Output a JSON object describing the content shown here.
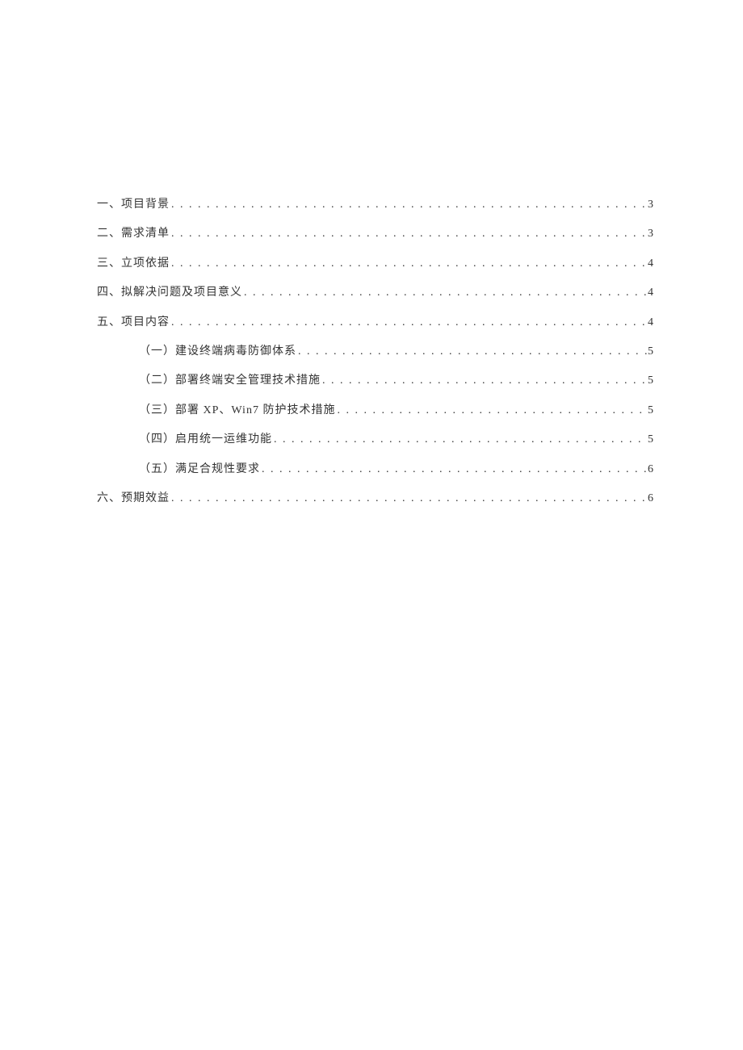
{
  "toc": [
    {
      "level": 1,
      "title": "一、项目背景",
      "page": "3"
    },
    {
      "level": 1,
      "title": "二、需求清单",
      "page": "3"
    },
    {
      "level": 1,
      "title": "三、立项依据",
      "page": "4"
    },
    {
      "level": 1,
      "title": "四、拟解决问题及项目意义",
      "page": "4"
    },
    {
      "level": 1,
      "title": "五、项目内容",
      "page": "4"
    },
    {
      "level": 2,
      "title": "（一）建设终端病毒防御体系",
      "page": "5"
    },
    {
      "level": 2,
      "title": "（二）部署终端安全管理技术措施",
      "page": "5"
    },
    {
      "level": 2,
      "title": "（三）部署 XP、Win7 防护技术措施",
      "page": "5"
    },
    {
      "level": 2,
      "title": "（四）启用统一运维功能",
      "page": "5"
    },
    {
      "level": 2,
      "title": "（五）满足合规性要求",
      "page": "6"
    },
    {
      "level": 1,
      "title": "六、预期效益",
      "page": "6"
    }
  ]
}
